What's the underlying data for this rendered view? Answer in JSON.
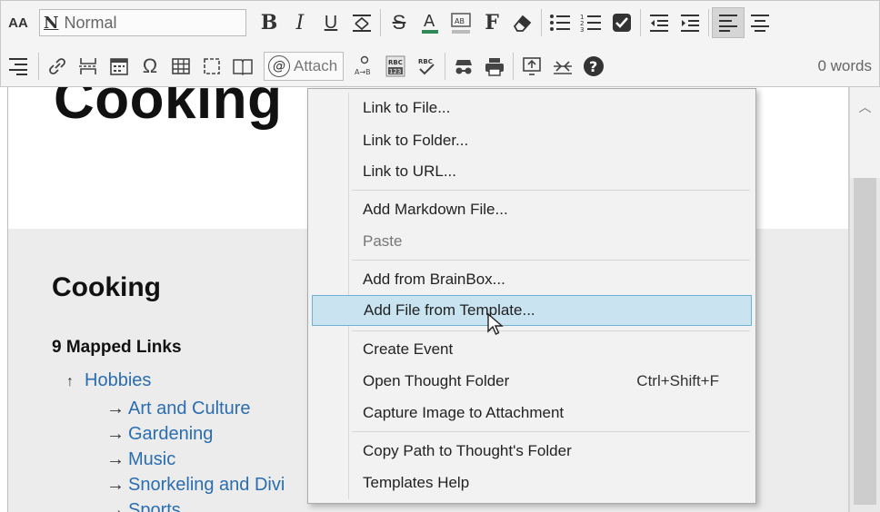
{
  "toolbar": {
    "font_size_glyph": "AA",
    "style_value": "Normal",
    "style_prefix": "N",
    "bold": "B",
    "italic": "I",
    "underline": "U",
    "attach_label": "Attach",
    "word_count": "0 words"
  },
  "document": {
    "big_title": "Cooking",
    "section_title": "Cooking",
    "mapped_links": "9 Mapped Links",
    "parent_link": "Hobbies",
    "children": [
      "Art and Culture",
      "Gardening",
      "Music",
      "Snorkeling and Divi",
      "Sports"
    ]
  },
  "menu": {
    "items": [
      {
        "label": "Link to File..."
      },
      {
        "label": "Link to Folder..."
      },
      {
        "label": "Link to URL..."
      },
      {
        "label": "Add Markdown File..."
      },
      {
        "label": "Paste"
      },
      {
        "label": "Add from BrainBox..."
      },
      {
        "label": "Add File from Template..."
      },
      {
        "label": "Create Event"
      },
      {
        "label": "Open Thought Folder",
        "shortcut": "Ctrl+Shift+F"
      },
      {
        "label": "Capture Image to Attachment"
      },
      {
        "label": "Copy Path to Thought's Folder"
      },
      {
        "label": "Templates Help"
      }
    ]
  },
  "colors": {
    "link": "#2a6db0",
    "highlight": "#c9e3f1",
    "highlight_border": "#6fb1d6"
  }
}
